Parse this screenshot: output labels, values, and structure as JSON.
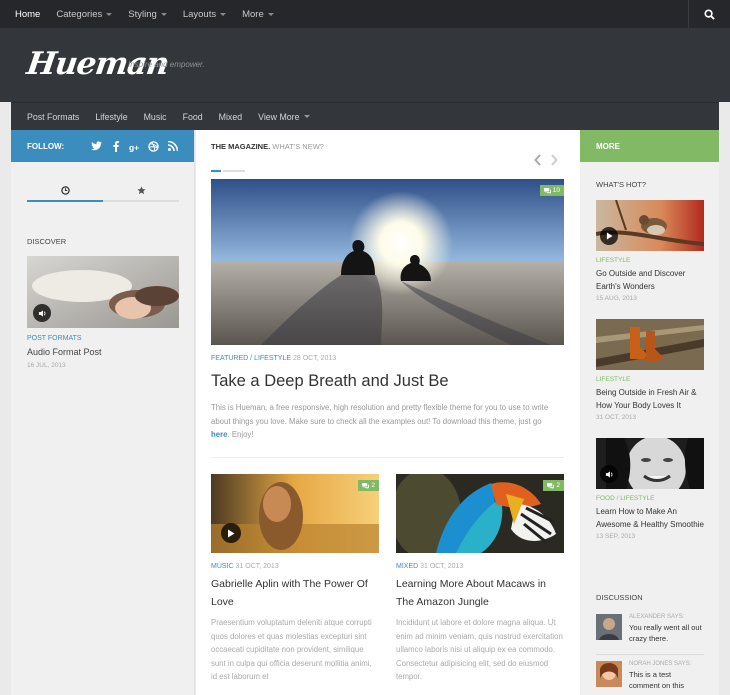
{
  "topnav": {
    "items": [
      {
        "label": "Home",
        "active": true,
        "dropdown": false
      },
      {
        "label": "Categories",
        "active": false,
        "dropdown": true
      },
      {
        "label": "Styling",
        "active": false,
        "dropdown": true
      },
      {
        "label": "Layouts",
        "active": false,
        "dropdown": true
      },
      {
        "label": "More",
        "active": false,
        "dropdown": true
      }
    ],
    "search_icon": "search-icon"
  },
  "header": {
    "logo": "Hueman",
    "tagline": "Inspire and empower."
  },
  "subnav": {
    "items": [
      "Post Formats",
      "Lifestyle",
      "Music",
      "Food",
      "Mixed"
    ],
    "view_more": "View More"
  },
  "left_sidebar": {
    "follow_label": "FOLLOW:",
    "social_icons": [
      "twitter-icon",
      "facebook-icon",
      "google-plus-icon",
      "dribbble-icon",
      "rss-icon"
    ],
    "discover_title": "DISCOVER",
    "discover_post": {
      "category": "POST FORMATS",
      "title": "Audio Format Post",
      "date": "16 JUL, 2013"
    }
  },
  "main": {
    "heading": "THE MAGAZINE.",
    "subheading": "WHAT'S NEW?",
    "featured": {
      "comments": "10",
      "category1": "FEATURED",
      "category2": "LIFESTYLE",
      "date": "28 OCT, 2013",
      "title": "Take a Deep Breath and Just Be",
      "excerpt": "This is Hueman, a free responsive, high resolution and pretty flexible theme for you to use to write about things you love. Make sure to check all the examples out! To download this theme, just go",
      "link_text": "here",
      "excerpt_end": ". Enjoy!"
    },
    "posts": [
      {
        "comments": "2",
        "category": "MUSIC",
        "date": "31 OCT, 2013",
        "title": "Gabrielle Aplin with The Power Of Love",
        "excerpt": "Praesentium voluptatum deleniti atque corrupti quos dolores et quas molestias excepturi sint occaecati cupiditate non provident, similique sunt in culpa qui officia deserunt mollitia animi, id est laborum et"
      },
      {
        "comments": "2",
        "category": "MIXED",
        "date": "31 OCT, 2013",
        "title": "Learning More About Macaws in The Amazon Jungle",
        "excerpt": "Incididunt ut labore et dolore magna aliqua. Ut enim ad minim veniam, quis nostrud exercitation ullamco laboris nisi ut aliquip ex ea commodo. Consectetur adipisicing elit, sed do eiusmod tempor."
      }
    ]
  },
  "right_sidebar": {
    "more_label": "MORE",
    "whats_hot": "WHAT'S HOT?",
    "hot_items": [
      {
        "category": "LIFESTYLE",
        "title": "Go Outside and Discover Earth's Wonders",
        "date": "15 AUG, 2013"
      },
      {
        "category": "LIFESTYLE",
        "title": "Being Outside in Fresh Air & How Your Body Loves It",
        "date": "31 OCT, 2013"
      },
      {
        "category": "FOOD / LIFESTYLE",
        "title": "Learn How to Make An Awesome & Healthy Smoothie",
        "date": "13 SEP, 2013"
      }
    ],
    "discussion_title": "DISCUSSION",
    "comments": [
      {
        "author": "ALEXANDER SAYS:",
        "text": "You really went all out crazy there."
      },
      {
        "author": "NORAH JONES SAYS:",
        "text": "This is a test comment on this"
      }
    ]
  },
  "colors": {
    "accent_blue": "#3b8dbd",
    "accent_green": "#82b965",
    "dark_nav": "#26272b",
    "header_bg": "#33363b"
  }
}
